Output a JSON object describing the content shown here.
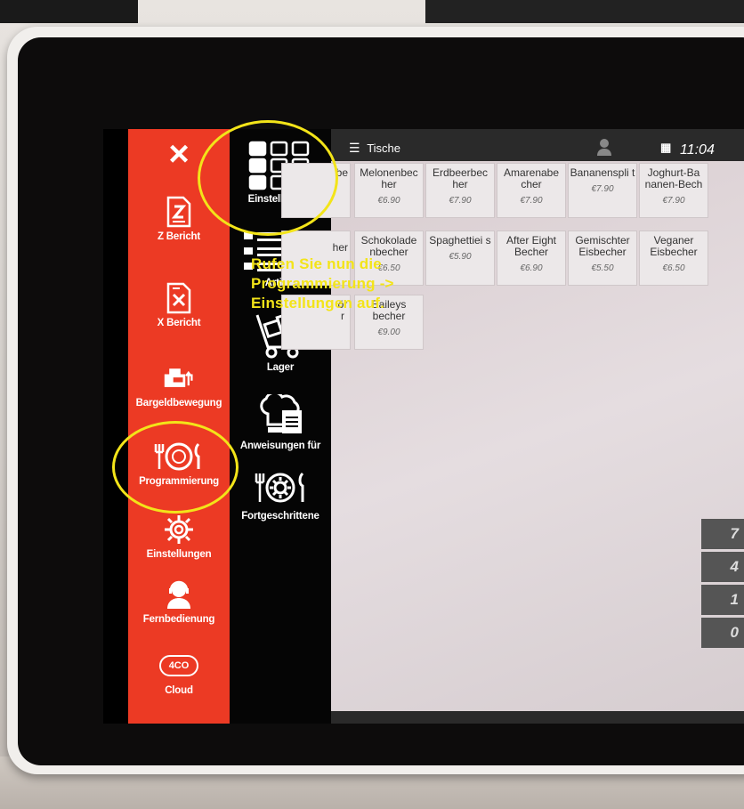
{
  "red_menu": {
    "close_label": "×",
    "items": [
      {
        "label": "Z Bericht",
        "icon": "z-report-icon"
      },
      {
        "label": "X Bericht",
        "icon": "x-report-icon"
      },
      {
        "label": "Bargeldbewegung",
        "icon": "cash-register-icon"
      },
      {
        "label": "Programmierung",
        "icon": "plate-cutlery-icon"
      },
      {
        "label": "Einstellungen",
        "icon": "gear-icon"
      },
      {
        "label": "Fernbedienung",
        "icon": "support-agent-icon"
      },
      {
        "label": "Cloud",
        "icon": "cloud-icon",
        "badge": "4CO"
      }
    ]
  },
  "sub_menu": {
    "items": [
      {
        "label": "Einstellungen",
        "icon": "grid-icon"
      },
      {
        "label": "Artikel",
        "icon": "article-list-icon"
      },
      {
        "label": "Lager",
        "icon": "hand-truck-icon"
      },
      {
        "label": "Anweisungen für",
        "icon": "chef-hat-icon"
      },
      {
        "label": "Fortgeschrittene",
        "icon": "advanced-gear-plate-icon"
      }
    ]
  },
  "topbar": {
    "tables_label": "Tische",
    "time": "11:04"
  },
  "products": [
    {
      "name": "Melonenbec her",
      "price": "€6.90"
    },
    {
      "name": "Erdbeerbec her",
      "price": "€7.90"
    },
    {
      "name": "Amarenabe cher",
      "price": "€7.90"
    },
    {
      "name": "Bananenspli t",
      "price": "€7.90"
    },
    {
      "name": "Joghurt-Ba nanen-Bech",
      "price": "€7.90"
    },
    {
      "name": "Schokolade nbecher",
      "price": "€6.50"
    },
    {
      "name": "Spaghettiei s",
      "price": "€5.90"
    },
    {
      "name": "After Eight Becher",
      "price": "€6.90"
    },
    {
      "name": "Gemischter Eisbecher",
      "price": "€5.50"
    },
    {
      "name": "Veganer Eisbecher",
      "price": "€6.50"
    },
    {
      "name": "Baileys becher",
      "price": "€9.00"
    }
  ],
  "partial_tiles": [
    "be",
    "her",
    "ör r"
  ],
  "numpad": [
    "7",
    "4",
    "1",
    "0"
  ],
  "annotation": {
    "line1": "Rufen Sie nun die",
    "line2": "Programmierung ->",
    "line3": "Einstellungen auf."
  },
  "colors": {
    "accent_red": "#ec3a24",
    "highlight_yellow": "#f3e419"
  }
}
